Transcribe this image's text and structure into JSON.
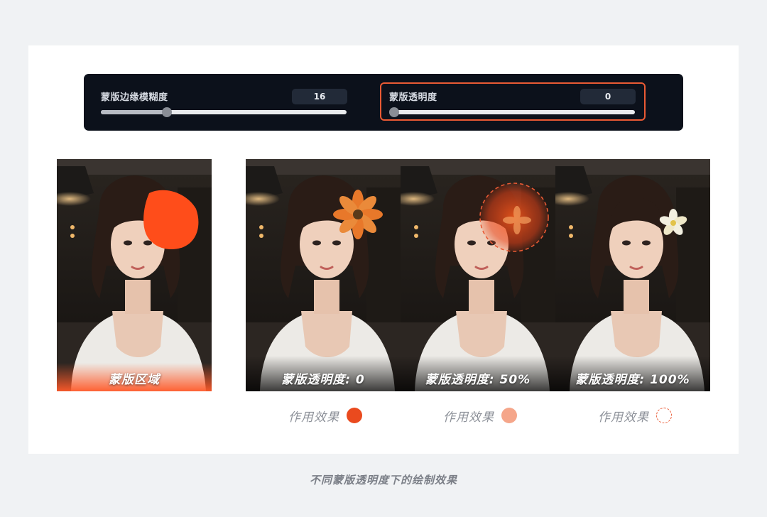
{
  "controls": {
    "feather": {
      "label": "蒙版边缘模糊度",
      "value": "16",
      "level": 0.26
    },
    "opacity": {
      "label": "蒙版透明度",
      "value": "0",
      "level": 0.0
    }
  },
  "panels": [
    {
      "caption": "蒙版区域",
      "variant": "mask"
    },
    {
      "caption": "蒙版透明度: 0",
      "variant": "orange-flower"
    },
    {
      "caption": "蒙版透明度: 50%",
      "variant": "half-mask"
    },
    {
      "caption": "蒙版透明度: 100%",
      "variant": "white-flower"
    }
  ],
  "effects": [
    {
      "label": "作用效果",
      "dot": "solid"
    },
    {
      "label": "作用效果",
      "dot": "light"
    },
    {
      "label": "作用效果",
      "dot": "dashed"
    }
  ],
  "footer": {
    "title": "不同蒙版透明度下的绘制效果"
  },
  "colors": {
    "accent": "#ea5a34",
    "mask": "#ff4d1a",
    "mask_light": "#f5a68a",
    "panel_bg": "#0c111b"
  },
  "icons": [
    "woman-portrait-photo",
    "orange-flower-icon",
    "white-flower-icon"
  ]
}
